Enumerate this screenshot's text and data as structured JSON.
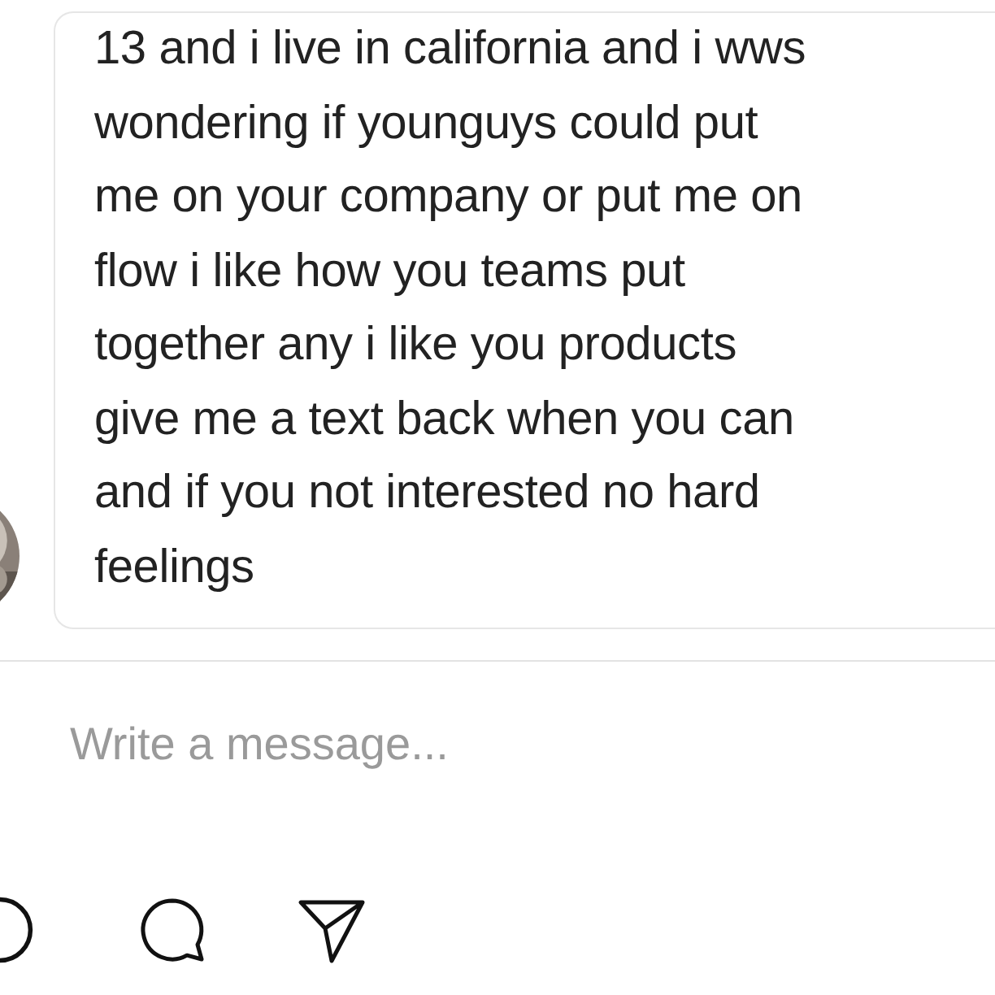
{
  "message": {
    "text": "13 and i live in california and i wws\nwondering if younguys could put\nme on your company or put me on\nflow i like how you teams put\ntogether any i like you products\ngive me a text back when you can\nand if you not interested no hard\nfeelings"
  },
  "composer": {
    "placeholder": "Write a message..."
  }
}
